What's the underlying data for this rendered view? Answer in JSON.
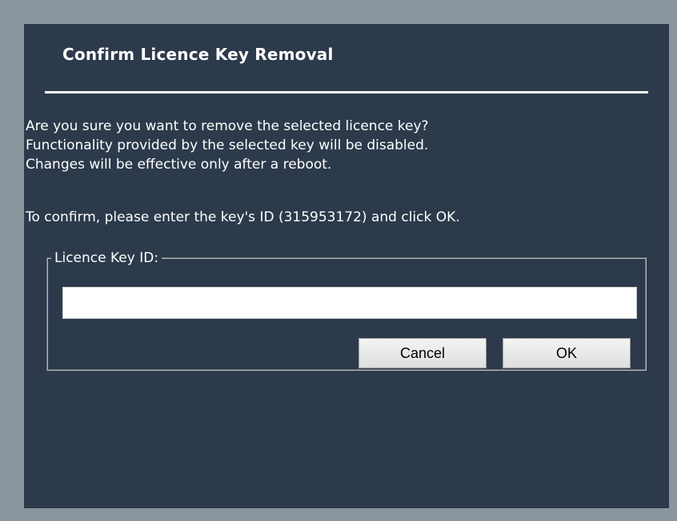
{
  "dialog": {
    "title": "Confirm Licence Key Removal",
    "message_lines": [
      "Are you sure you want to remove the selected licence key?",
      "Functionality provided by the selected key will be disabled.",
      "Changes will be effective only after a reboot."
    ],
    "confirm_text": "To confirm, please enter the key's ID (315953172) and click OK.",
    "fieldset": {
      "legend": "Licence Key ID:",
      "input_value": "",
      "input_placeholder": ""
    },
    "buttons": {
      "cancel_label": "Cancel",
      "ok_label": "OK"
    }
  },
  "colors": {
    "dialog_background": "#2c3a4b",
    "page_background": "#8a959e",
    "text": "#ffffff"
  }
}
